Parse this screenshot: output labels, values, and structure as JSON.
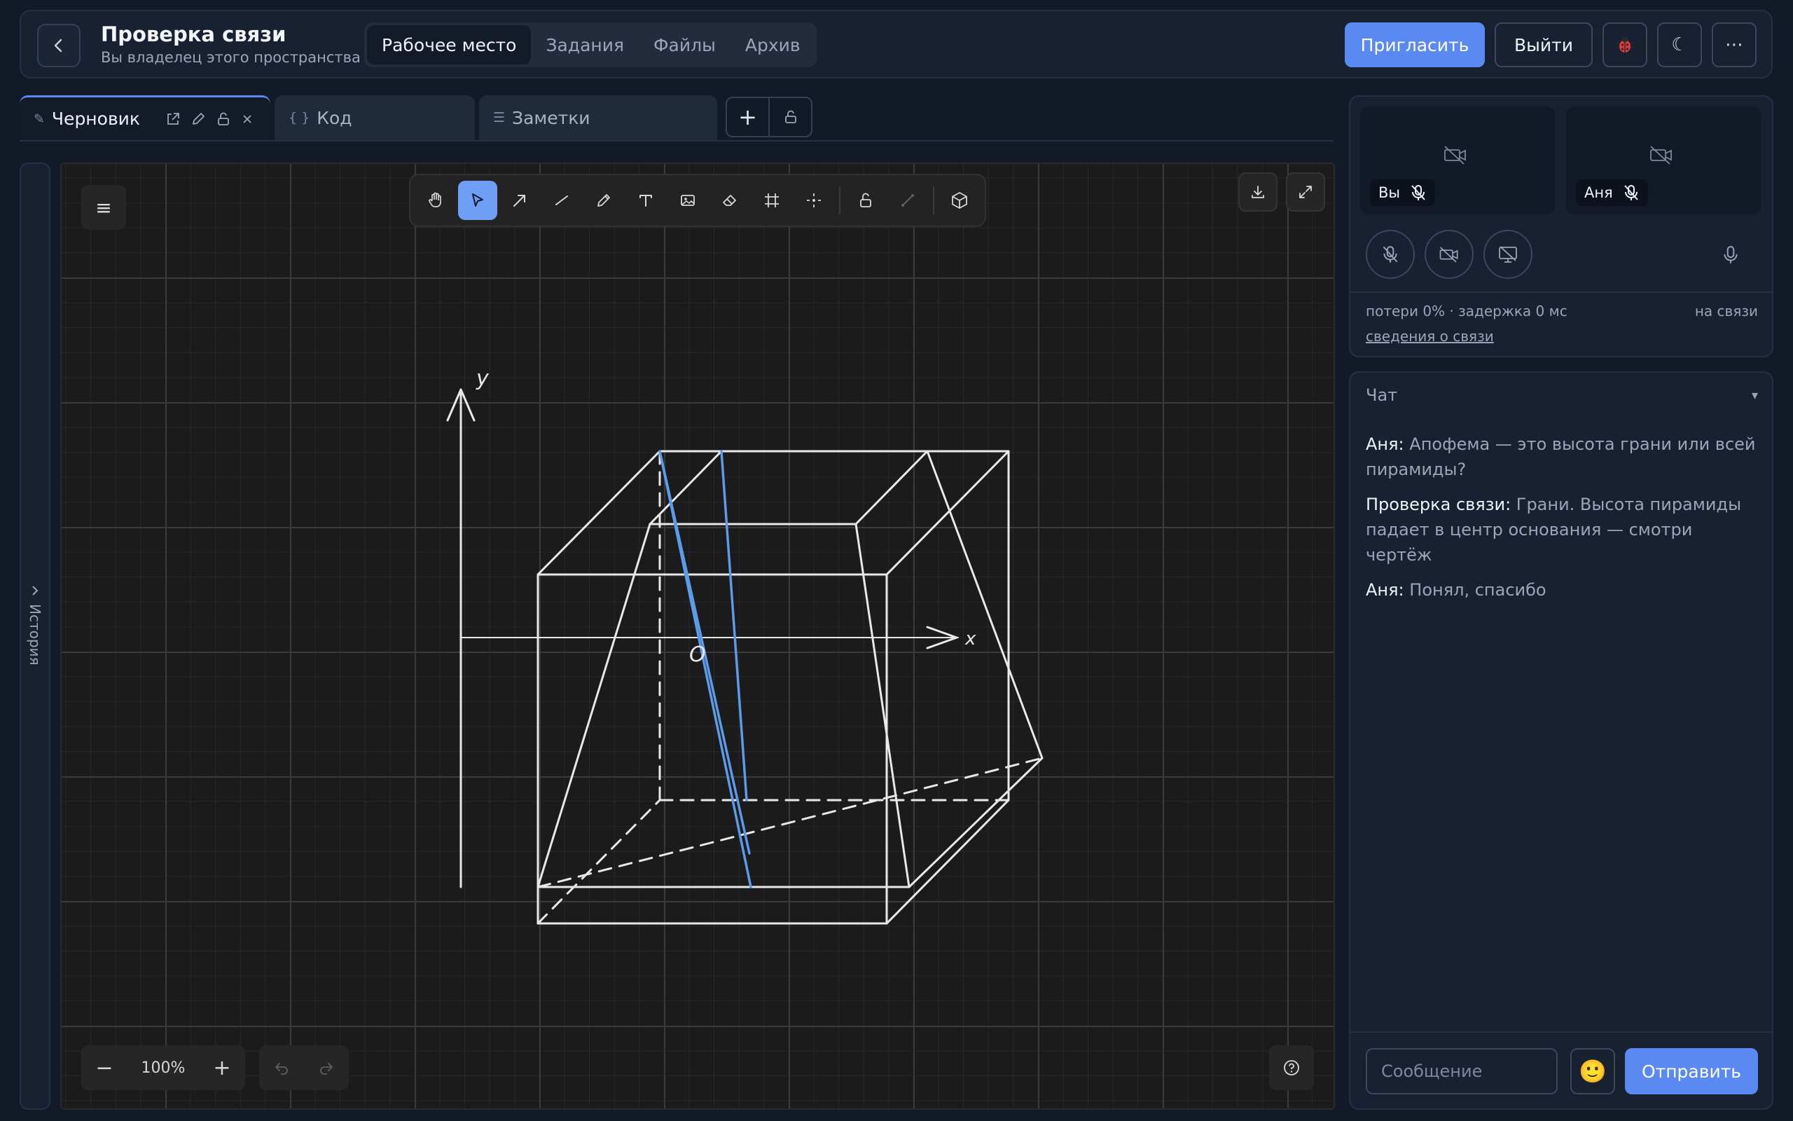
{
  "colors": {
    "accent": "#5a8af1",
    "sketch_line": "#e8e8e8",
    "sketch_highlight": "#5b9be8",
    "canvas_bg": "#1b1b1b"
  },
  "header": {
    "title": "Проверка связи",
    "subtitle": "Вы владелец этого пространства",
    "nav_tabs": [
      {
        "label": "Рабочее место",
        "active": true
      },
      {
        "label": "Задания",
        "active": false
      },
      {
        "label": "Файлы",
        "active": false
      },
      {
        "label": "Архив",
        "active": false
      }
    ],
    "invite_label": "Пригласить",
    "exit_label": "Выйти",
    "icons": [
      "bug-icon",
      "moon-icon",
      "more-icon"
    ]
  },
  "doc_tabs": [
    {
      "label": "Черновик",
      "icon": "pencil-icon",
      "active": true
    },
    {
      "label": "Код",
      "icon": "braces-icon",
      "active": false
    },
    {
      "label": "Заметки",
      "icon": "list-icon",
      "active": false
    }
  ],
  "history": {
    "label": "История"
  },
  "canvas": {
    "tools": [
      "hand",
      "select",
      "arrow",
      "line",
      "pencil",
      "text",
      "image",
      "eraser",
      "frame",
      "laser",
      "lock",
      "connector",
      "3d-box"
    ],
    "active_tool": "select",
    "zoom": "100%",
    "sketch": {
      "axis_y": "y",
      "axis_x": "x",
      "origin": "O"
    }
  },
  "call": {
    "tiles": [
      {
        "name": "Вы",
        "muted": true,
        "camera_off": true
      },
      {
        "name": "Аня",
        "muted": true,
        "camera_off": true
      }
    ],
    "stats": "потери 0% · задержка 0 мс",
    "status": "на связи",
    "details_link": "сведения о связи"
  },
  "chat": {
    "title": "Чат",
    "toggle": "▾",
    "messages": [
      {
        "author": "Аня:",
        "text": " Апофема — это высота грани или всей пирамиды?"
      },
      {
        "author": "Проверка связи:",
        "text": " Грани. Высота пирамиды падает в центр основания — смотри чертёж"
      },
      {
        "author": "Аня:",
        "text": " Понял, спасибо"
      }
    ],
    "input_placeholder": "Сообщение",
    "emoji": "🙂",
    "send_label": "Отправить"
  }
}
